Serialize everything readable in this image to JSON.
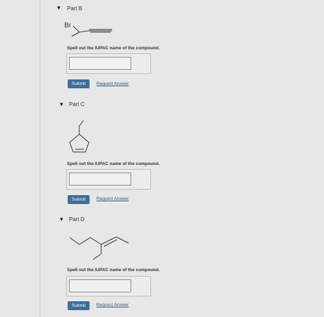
{
  "parts": [
    {
      "title": "Part B",
      "structure_label": "Br",
      "prompt": "Spell out the IUPAC name of the compound.",
      "answer_value": "",
      "submit_label": "Submit",
      "request_label": "Request Answer"
    },
    {
      "title": "Part C",
      "prompt": "Spell out the IUPAC name of the compound.",
      "answer_value": "",
      "submit_label": "Submit",
      "request_label": "Request Answer"
    },
    {
      "title": "Part D",
      "prompt": "Spell out the IUPAC name of the compound.",
      "answer_value": "",
      "submit_label": "Submit",
      "request_label": "Request Answer"
    }
  ],
  "colors": {
    "accent": "#3b6f9d",
    "link": "#2a5a86",
    "background": "#e7e7e7"
  },
  "icons": {
    "toggle": "caret-down-icon"
  }
}
